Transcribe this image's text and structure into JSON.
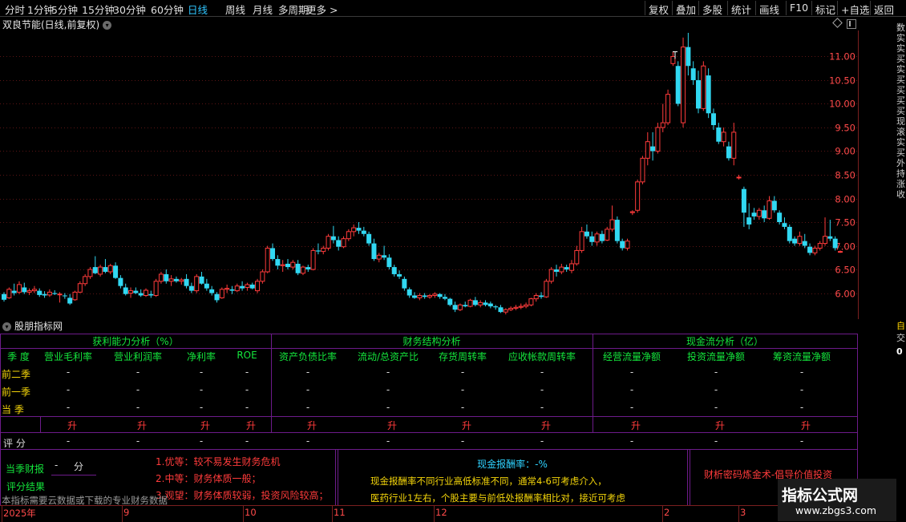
{
  "toolbar": {
    "periods": [
      "分时",
      "1分钟",
      "5分钟",
      "15分钟",
      "30分钟",
      "60分钟",
      "日线",
      "周线",
      "月线",
      "多周期",
      "更多 >"
    ],
    "active_period": "日线",
    "actions": [
      "复权",
      "叠加",
      "多股",
      "统计",
      "画线",
      "F10",
      "标记",
      "+自选",
      "返回"
    ]
  },
  "chart_title": "双良节能(日线,前复权)",
  "price_axis": [
    "11.00",
    "10.50",
    "10.00",
    "9.50",
    "9.00",
    "8.50",
    "8.00",
    "7.50",
    "7.00",
    "6.50",
    "6.00"
  ],
  "colors": {
    "up": "#ff3b3b",
    "down": "#31d8f2",
    "grid": "#5a1414",
    "frame": "#7a1f1f",
    "table": "#6d1b8a"
  },
  "chart_data": {
    "type": "candlestick",
    "ylim": [
      5.45,
      11.55
    ],
    "candles": [
      {
        "o": 5.98,
        "h": 6.02,
        "l": 5.82,
        "c": 5.86
      },
      {
        "o": 5.9,
        "h": 6.12,
        "l": 5.88,
        "c": 6.08
      },
      {
        "o": 6.05,
        "h": 6.2,
        "l": 5.95,
        "c": 6.0
      },
      {
        "o": 6.02,
        "h": 6.25,
        "l": 5.98,
        "c": 6.18
      },
      {
        "o": 6.12,
        "h": 6.22,
        "l": 5.98,
        "c": 6.02
      },
      {
        "o": 6.02,
        "h": 6.1,
        "l": 5.96,
        "c": 6.05
      },
      {
        "o": 6.05,
        "h": 6.15,
        "l": 6.0,
        "c": 6.08
      },
      {
        "o": 6.05,
        "h": 6.1,
        "l": 5.92,
        "c": 5.96
      },
      {
        "o": 5.98,
        "h": 6.04,
        "l": 5.9,
        "c": 5.95
      },
      {
        "o": 5.96,
        "h": 6.08,
        "l": 5.92,
        "c": 6.02
      },
      {
        "o": 6.0,
        "h": 6.06,
        "l": 5.96,
        "c": 5.98
      },
      {
        "o": 5.98,
        "h": 6.02,
        "l": 5.8,
        "c": 5.98
      },
      {
        "o": 5.95,
        "h": 6.0,
        "l": 5.88,
        "c": 5.94
      },
      {
        "o": 5.9,
        "h": 5.98,
        "l": 5.75,
        "c": 5.78
      },
      {
        "o": 5.86,
        "h": 6.05,
        "l": 5.84,
        "c": 6.02
      },
      {
        "o": 6.02,
        "h": 6.25,
        "l": 6.0,
        "c": 6.2
      },
      {
        "o": 6.2,
        "h": 6.4,
        "l": 6.15,
        "c": 6.35
      },
      {
        "o": 6.35,
        "h": 6.55,
        "l": 6.3,
        "c": 6.5
      },
      {
        "o": 6.55,
        "h": 6.78,
        "l": 6.4,
        "c": 6.42
      },
      {
        "o": 6.4,
        "h": 6.6,
        "l": 6.35,
        "c": 6.55
      },
      {
        "o": 6.55,
        "h": 6.72,
        "l": 6.42,
        "c": 6.45
      },
      {
        "o": 6.45,
        "h": 6.62,
        "l": 6.4,
        "c": 6.58
      },
      {
        "o": 6.58,
        "h": 6.65,
        "l": 6.3,
        "c": 6.32
      },
      {
        "o": 6.32,
        "h": 6.38,
        "l": 6.1,
        "c": 6.15
      },
      {
        "o": 6.12,
        "h": 6.2,
        "l": 5.95,
        "c": 5.98
      },
      {
        "o": 6.0,
        "h": 6.12,
        "l": 5.9,
        "c": 6.05
      },
      {
        "o": 6.05,
        "h": 6.12,
        "l": 5.98,
        "c": 6.0
      },
      {
        "o": 6.0,
        "h": 6.08,
        "l": 5.92,
        "c": 5.95
      },
      {
        "o": 5.95,
        "h": 6.1,
        "l": 5.92,
        "c": 6.06
      },
      {
        "o": 5.98,
        "h": 6.05,
        "l": 5.9,
        "c": 5.95
      },
      {
        "o": 5.95,
        "h": 6.3,
        "l": 5.92,
        "c": 6.25
      },
      {
        "o": 6.25,
        "h": 6.45,
        "l": 6.2,
        "c": 6.4
      },
      {
        "o": 6.4,
        "h": 6.5,
        "l": 6.2,
        "c": 6.25
      },
      {
        "o": 6.25,
        "h": 6.38,
        "l": 6.15,
        "c": 6.3
      },
      {
        "o": 6.3,
        "h": 6.35,
        "l": 6.22,
        "c": 6.25
      },
      {
        "o": 6.25,
        "h": 6.32,
        "l": 6.18,
        "c": 6.28
      },
      {
        "o": 6.3,
        "h": 6.4,
        "l": 6.1,
        "c": 6.15
      },
      {
        "o": 6.15,
        "h": 6.22,
        "l": 6.0,
        "c": 6.05
      },
      {
        "o": 6.05,
        "h": 6.4,
        "l": 6.0,
        "c": 6.35
      },
      {
        "o": 6.35,
        "h": 6.45,
        "l": 6.18,
        "c": 6.2
      },
      {
        "o": 6.2,
        "h": 6.3,
        "l": 6.05,
        "c": 6.1
      },
      {
        "o": 6.08,
        "h": 6.15,
        "l": 5.95,
        "c": 6.0
      },
      {
        "o": 5.98,
        "h": 6.02,
        "l": 5.8,
        "c": 5.85
      },
      {
        "o": 5.9,
        "h": 6.12,
        "l": 5.88,
        "c": 6.08
      },
      {
        "o": 6.08,
        "h": 6.18,
        "l": 6.0,
        "c": 6.1
      },
      {
        "o": 6.08,
        "h": 6.15,
        "l": 5.98,
        "c": 6.05
      },
      {
        "o": 6.05,
        "h": 6.2,
        "l": 6.02,
        "c": 6.15
      },
      {
        "o": 6.15,
        "h": 6.25,
        "l": 6.05,
        "c": 6.1
      },
      {
        "o": 6.12,
        "h": 6.22,
        "l": 6.05,
        "c": 6.18
      },
      {
        "o": 6.18,
        "h": 6.22,
        "l": 6.08,
        "c": 6.1
      },
      {
        "o": 6.05,
        "h": 6.3,
        "l": 6.0,
        "c": 6.25
      },
      {
        "o": 6.25,
        "h": 6.5,
        "l": 6.2,
        "c": 6.45
      },
      {
        "o": 6.45,
        "h": 7.0,
        "l": 6.42,
        "c": 6.95
      },
      {
        "o": 6.95,
        "h": 7.05,
        "l": 6.68,
        "c": 6.72
      },
      {
        "o": 6.72,
        "h": 6.8,
        "l": 6.5,
        "c": 6.58
      },
      {
        "o": 6.58,
        "h": 6.7,
        "l": 6.45,
        "c": 6.6
      },
      {
        "o": 6.62,
        "h": 6.72,
        "l": 6.5,
        "c": 6.55
      },
      {
        "o": 6.55,
        "h": 6.7,
        "l": 6.5,
        "c": 6.65
      },
      {
        "o": 6.62,
        "h": 6.7,
        "l": 6.38,
        "c": 6.42
      },
      {
        "o": 6.42,
        "h": 6.58,
        "l": 6.38,
        "c": 6.55
      },
      {
        "o": 6.55,
        "h": 6.6,
        "l": 6.45,
        "c": 6.5
      },
      {
        "o": 6.5,
        "h": 6.95,
        "l": 6.48,
        "c": 6.9
      },
      {
        "o": 6.9,
        "h": 7.05,
        "l": 6.82,
        "c": 6.88
      },
      {
        "o": 6.88,
        "h": 7.0,
        "l": 6.82,
        "c": 6.95
      },
      {
        "o": 6.95,
        "h": 7.25,
        "l": 6.9,
        "c": 7.2
      },
      {
        "o": 7.2,
        "h": 7.42,
        "l": 7.05,
        "c": 7.12
      },
      {
        "o": 7.12,
        "h": 7.2,
        "l": 6.9,
        "c": 6.98
      },
      {
        "o": 6.98,
        "h": 7.2,
        "l": 6.95,
        "c": 7.15
      },
      {
        "o": 7.15,
        "h": 7.35,
        "l": 7.1,
        "c": 7.3
      },
      {
        "o": 7.3,
        "h": 7.45,
        "l": 7.2,
        "c": 7.38
      },
      {
        "o": 7.38,
        "h": 7.5,
        "l": 7.25,
        "c": 7.32
      },
      {
        "o": 7.32,
        "h": 7.4,
        "l": 7.2,
        "c": 7.25
      },
      {
        "o": 7.25,
        "h": 7.3,
        "l": 7.0,
        "c": 7.05
      },
      {
        "o": 7.05,
        "h": 7.15,
        "l": 6.68,
        "c": 6.72
      },
      {
        "o": 6.72,
        "h": 6.85,
        "l": 6.65,
        "c": 6.8
      },
      {
        "o": 6.8,
        "h": 7.0,
        "l": 6.7,
        "c": 6.75
      },
      {
        "o": 6.75,
        "h": 6.82,
        "l": 6.5,
        "c": 6.55
      },
      {
        "o": 6.55,
        "h": 6.6,
        "l": 6.35,
        "c": 6.4
      },
      {
        "o": 6.4,
        "h": 6.48,
        "l": 6.3,
        "c": 6.35
      },
      {
        "o": 6.3,
        "h": 6.35,
        "l": 6.05,
        "c": 6.1
      },
      {
        "o": 6.08,
        "h": 6.12,
        "l": 5.9,
        "c": 5.95
      },
      {
        "o": 5.95,
        "h": 6.02,
        "l": 5.88,
        "c": 5.9
      },
      {
        "o": 5.9,
        "h": 6.0,
        "l": 5.85,
        "c": 5.95
      },
      {
        "o": 5.95,
        "h": 6.0,
        "l": 5.88,
        "c": 5.92
      },
      {
        "o": 5.92,
        "h": 5.98,
        "l": 5.88,
        "c": 5.95
      },
      {
        "o": 5.95,
        "h": 6.02,
        "l": 5.9,
        "c": 5.98
      },
      {
        "o": 5.98,
        "h": 6.0,
        "l": 5.88,
        "c": 5.92
      },
      {
        "o": 5.92,
        "h": 5.98,
        "l": 5.85,
        "c": 5.88
      },
      {
        "o": 5.88,
        "h": 5.9,
        "l": 5.72,
        "c": 5.75
      },
      {
        "o": 5.75,
        "h": 5.82,
        "l": 5.6,
        "c": 5.65
      },
      {
        "o": 5.65,
        "h": 5.78,
        "l": 5.62,
        "c": 5.75
      },
      {
        "o": 5.75,
        "h": 5.82,
        "l": 5.7,
        "c": 5.72
      },
      {
        "o": 5.72,
        "h": 5.88,
        "l": 5.7,
        "c": 5.85
      },
      {
        "o": 5.85,
        "h": 5.92,
        "l": 5.72,
        "c": 5.75
      },
      {
        "o": 5.75,
        "h": 5.85,
        "l": 5.7,
        "c": 5.8
      },
      {
        "o": 5.8,
        "h": 5.85,
        "l": 5.72,
        "c": 5.75
      },
      {
        "o": 5.78,
        "h": 5.82,
        "l": 5.68,
        "c": 5.72
      },
      {
        "o": 5.72,
        "h": 5.75,
        "l": 5.65,
        "c": 5.7
      },
      {
        "o": 5.7,
        "h": 5.75,
        "l": 5.58,
        "c": 5.6
      },
      {
        "o": 5.6,
        "h": 5.68,
        "l": 5.55,
        "c": 5.65
      },
      {
        "o": 5.65,
        "h": 5.72,
        "l": 5.62,
        "c": 5.68
      },
      {
        "o": 5.68,
        "h": 5.75,
        "l": 5.64,
        "c": 5.7
      },
      {
        "o": 5.7,
        "h": 5.78,
        "l": 5.66,
        "c": 5.72
      },
      {
        "o": 5.72,
        "h": 5.8,
        "l": 5.68,
        "c": 5.75
      },
      {
        "o": 5.75,
        "h": 5.9,
        "l": 5.72,
        "c": 5.88
      },
      {
        "o": 5.88,
        "h": 6.0,
        "l": 5.82,
        "c": 5.95
      },
      {
        "o": 5.95,
        "h": 6.02,
        "l": 5.88,
        "c": 5.92
      },
      {
        "o": 5.92,
        "h": 6.3,
        "l": 5.9,
        "c": 6.25
      },
      {
        "o": 6.25,
        "h": 6.55,
        "l": 6.2,
        "c": 6.5
      },
      {
        "o": 6.5,
        "h": 6.6,
        "l": 6.35,
        "c": 6.45
      },
      {
        "o": 6.45,
        "h": 6.62,
        "l": 6.4,
        "c": 6.55
      },
      {
        "o": 6.55,
        "h": 6.6,
        "l": 6.45,
        "c": 6.5
      },
      {
        "o": 6.48,
        "h": 6.7,
        "l": 6.42,
        "c": 6.62
      },
      {
        "o": 6.62,
        "h": 7.0,
        "l": 6.58,
        "c": 6.9
      },
      {
        "o": 6.9,
        "h": 7.4,
        "l": 6.85,
        "c": 7.3
      },
      {
        "o": 7.3,
        "h": 7.45,
        "l": 7.15,
        "c": 7.2
      },
      {
        "o": 7.2,
        "h": 7.3,
        "l": 7.0,
        "c": 7.08
      },
      {
        "o": 7.08,
        "h": 7.3,
        "l": 7.0,
        "c": 7.25
      },
      {
        "o": 7.25,
        "h": 7.32,
        "l": 7.05,
        "c": 7.1
      },
      {
        "o": 7.12,
        "h": 7.4,
        "l": 7.1,
        "c": 7.35
      },
      {
        "o": 7.35,
        "h": 7.85,
        "l": 7.3,
        "c": 7.55
      },
      {
        "o": 7.55,
        "h": 7.62,
        "l": 7.05,
        "c": 7.1
      },
      {
        "o": 7.1,
        "h": 7.15,
        "l": 6.9,
        "c": 6.95
      },
      {
        "o": 6.95,
        "h": 7.15,
        "l": 6.9,
        "c": 7.1
      },
      {
        "o": 7.7,
        "h": 7.75,
        "l": 7.65,
        "c": 7.72
      },
      {
        "o": 7.75,
        "h": 8.4,
        "l": 7.7,
        "c": 8.35
      },
      {
        "o": 8.35,
        "h": 8.9,
        "l": 8.3,
        "c": 8.85
      },
      {
        "o": 8.85,
        "h": 9.4,
        "l": 8.7,
        "c": 9.2
      },
      {
        "o": 9.1,
        "h": 9.4,
        "l": 8.8,
        "c": 9.0
      },
      {
        "o": 9.0,
        "h": 9.6,
        "l": 8.95,
        "c": 9.5
      },
      {
        "o": 9.5,
        "h": 10.0,
        "l": 9.4,
        "c": 9.6
      },
      {
        "o": 9.6,
        "h": 10.3,
        "l": 9.55,
        "c": 10.2
      },
      {
        "o": 10.85,
        "h": 11.1,
        "l": 10.8,
        "c": 11.0
      },
      {
        "o": 10.8,
        "h": 10.9,
        "l": 9.95,
        "c": 10.0
      },
      {
        "o": 9.6,
        "h": 11.4,
        "l": 9.5,
        "c": 11.2
      },
      {
        "o": 11.2,
        "h": 11.5,
        "l": 10.6,
        "c": 10.8
      },
      {
        "o": 10.75,
        "h": 10.9,
        "l": 10.4,
        "c": 10.5
      },
      {
        "o": 10.5,
        "h": 10.7,
        "l": 9.8,
        "c": 9.9
      },
      {
        "o": 9.9,
        "h": 10.9,
        "l": 9.85,
        "c": 10.8
      },
      {
        "o": 10.6,
        "h": 10.75,
        "l": 9.7,
        "c": 9.8
      },
      {
        "o": 9.8,
        "h": 9.9,
        "l": 9.45,
        "c": 9.55
      },
      {
        "o": 9.5,
        "h": 9.6,
        "l": 9.15,
        "c": 9.2
      },
      {
        "o": 9.2,
        "h": 9.5,
        "l": 9.1,
        "c": 9.4
      },
      {
        "o": 9.1,
        "h": 9.2,
        "l": 8.8,
        "c": 8.85
      },
      {
        "o": 8.85,
        "h": 9.6,
        "l": 8.7,
        "c": 9.4
      },
      {
        "o": 8.45,
        "h": 8.5,
        "l": 8.4,
        "c": 8.45
      },
      {
        "o": 8.2,
        "h": 8.25,
        "l": 7.4,
        "c": 7.7
      },
      {
        "o": 7.6,
        "h": 7.9,
        "l": 7.35,
        "c": 7.45
      },
      {
        "o": 7.7,
        "h": 7.8,
        "l": 7.55,
        "c": 7.62
      },
      {
        "o": 7.62,
        "h": 7.8,
        "l": 7.55,
        "c": 7.75
      },
      {
        "o": 7.75,
        "h": 7.85,
        "l": 7.5,
        "c": 7.58
      },
      {
        "o": 7.58,
        "h": 8.05,
        "l": 7.55,
        "c": 7.95
      },
      {
        "o": 7.95,
        "h": 8.05,
        "l": 7.7,
        "c": 7.75
      },
      {
        "o": 7.7,
        "h": 7.75,
        "l": 7.45,
        "c": 7.5
      },
      {
        "o": 7.48,
        "h": 7.6,
        "l": 7.35,
        "c": 7.4
      },
      {
        "o": 7.4,
        "h": 7.45,
        "l": 7.05,
        "c": 7.1
      },
      {
        "o": 7.15,
        "h": 7.2,
        "l": 7.0,
        "c": 7.05
      },
      {
        "o": 7.05,
        "h": 7.3,
        "l": 7.0,
        "c": 7.2
      },
      {
        "o": 7.1,
        "h": 7.25,
        "l": 6.95,
        "c": 7.0
      },
      {
        "o": 6.98,
        "h": 7.05,
        "l": 6.8,
        "c": 6.85
      },
      {
        "o": 6.85,
        "h": 7.0,
        "l": 6.8,
        "c": 6.95
      },
      {
        "o": 6.95,
        "h": 7.1,
        "l": 6.9,
        "c": 7.05
      },
      {
        "o": 7.05,
        "h": 7.6,
        "l": 7.0,
        "c": 7.2
      },
      {
        "o": 7.2,
        "h": 7.55,
        "l": 7.1,
        "c": 7.15
      },
      {
        "o": 7.15,
        "h": 7.2,
        "l": 6.9,
        "c": 6.95
      },
      {
        "o": 6.88,
        "h": 6.9,
        "l": 6.85,
        "c": 6.88
      }
    ]
  },
  "panel": {
    "title": "股朋指标网",
    "group_headers": [
      "获利能力分析（%）",
      "财务结构分析",
      "现金流分析（亿）"
    ],
    "row_label_header": "季 度",
    "columns": [
      "营业毛利率",
      "营业利润率",
      "净利率",
      "ROE",
      "资产负债比率",
      "流动/总资产比",
      "存货周转率",
      "应收帐款周转率",
      "经营流量净额",
      "投资流量净额",
      "筹资流量净额"
    ],
    "rows": [
      {
        "label": "前二季",
        "values": [
          "-",
          "-",
          "-",
          "-",
          "-",
          "-",
          "-",
          "-",
          "-",
          "-",
          "-"
        ]
      },
      {
        "label": "前一季",
        "values": [
          "-",
          "-",
          "-",
          "-",
          "-",
          "-",
          "-",
          "-",
          "-",
          "-",
          "-"
        ]
      },
      {
        "label": "当 季",
        "values": [
          "-",
          "-",
          "-",
          "-",
          "-",
          "-",
          "-",
          "-",
          "-",
          "-",
          "-"
        ]
      }
    ],
    "trend": [
      "升",
      "升",
      "升",
      "升",
      "升",
      "升",
      "升",
      "升",
      "升",
      "升",
      "升"
    ],
    "score_label": "评 分",
    "scores": [
      "-",
      "-",
      "-",
      "-",
      "-",
      "-",
      "-",
      "-",
      "-",
      "-",
      "-"
    ],
    "report_label": "当季财报",
    "report_value": "-",
    "report_unit": "分",
    "result_label": "评分结果",
    "legend": [
      "1.优等：较不易发生财务危机",
      "2.中等：财务体质一般；",
      "3.观望：财务体质较弱，投资风险较高；"
    ],
    "note": "本指标需要云数据或下载的专业财务数据",
    "cash_title": "现金报酬率：-%",
    "cash_line1": "现金报酬率不同行业高低标准不同，通常4-6可考虑介入，",
    "cash_line2": "医药行业1左右，个股主要与前低处报酬率相比对，接近可考虑",
    "slogan": "财析密码炼金术-倡导价值投资"
  },
  "time_axis": [
    "2025年",
    "9",
    "10",
    "11",
    "12",
    "2",
    "3"
  ],
  "watermark": {
    "name": "指标公式网",
    "url": "www.zbgs3.com"
  },
  "right_strip": [
    "数",
    "实",
    "实",
    "买",
    "实",
    "买",
    "买",
    "买",
    "买",
    "现",
    "滚",
    "实",
    "买",
    "外",
    "持",
    "涨",
    "收"
  ],
  "right_bottom": [
    "自",
    "交",
    "0"
  ]
}
